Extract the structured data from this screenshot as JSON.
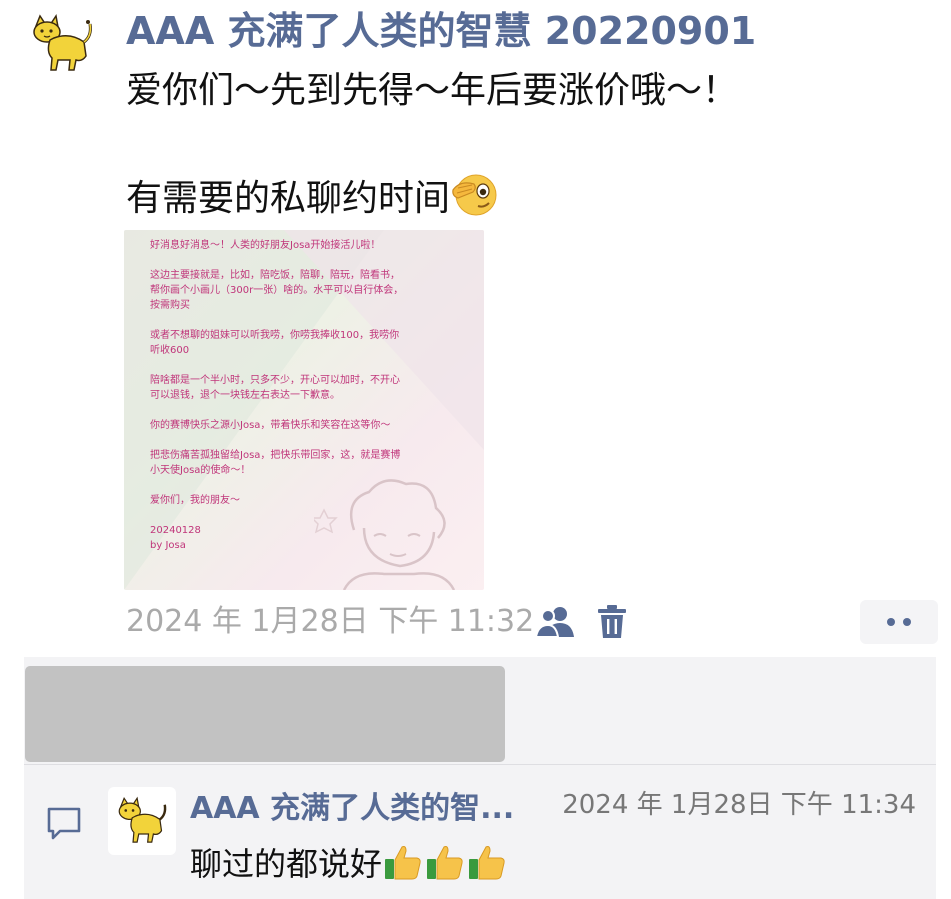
{
  "post": {
    "author": "AAA 充满了人类的智慧 20220901",
    "text": "爱你们～先到先得～年后要涨价哦～！\n\n有需要的私聊约时间",
    "image": {
      "lines": "好消息好消息～！人类的好朋友Josa开始接活儿啦！\n\n这边主要接就是，比如，陪吃饭，陪聊，陪玩，陪看书，\n帮你画个小画儿（300r一张）啥的。水平可以自行体会，\n按需购买\n\n或者不想聊的姐妹可以听我唠，你唠我捧收100，我唠你\n听收600\n\n陪啥都是一个半小时，只多不少，开心可以加时，不开心\n可以退钱，退个一块钱左右表达一下歉意。\n\n你的赛博快乐之源小Josa，带着快乐和笑容在这等你～\n\n把悲伤痛苦孤独留给Josa，把快乐带回家，这，就是赛博\n小天使Josa的使命～！\n\n爱你们，我的朋友～\n\n20240128\nby Josa"
    },
    "timestamp": "2024 年 1月28日 下午 11:32"
  },
  "comment": {
    "author": "AAA 充满了人类的智...",
    "time": "2024 年 1月28日 下午 11:34",
    "text": "聊过的都说好"
  },
  "icons": {
    "avatar": "cat-icon",
    "emoji": "face-with-hand-over-eye-icon",
    "visibility": "people-icon",
    "delete": "trash-icon",
    "more": "more-dots-icon",
    "comment": "comment-icon",
    "thumbs": "thumbs-up-icon"
  },
  "colors": {
    "link": "#576b95",
    "timestamp": "#aaaaaa",
    "poster_text": "#c0357a",
    "panel": "#f3f3f5",
    "redacted": "#c2c2c2"
  }
}
